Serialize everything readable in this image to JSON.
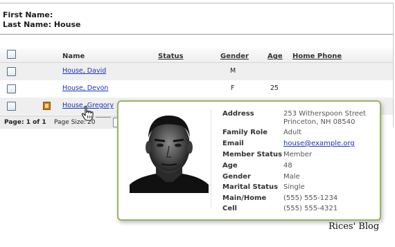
{
  "search_summary": {
    "first_name_label": "First Name:",
    "last_name_label": "Last Name: House"
  },
  "grid": {
    "columns": {
      "name": "Name",
      "status": "Status",
      "gender": "Gender",
      "age": "Age",
      "home_phone": "Home Phone"
    },
    "rows": [
      {
        "name": "House, David",
        "status": "",
        "gender": "M",
        "age": ""
      },
      {
        "name": "House, Devon",
        "status": "",
        "gender": "F",
        "age": "25"
      },
      {
        "name": "House, Gregory",
        "status": "",
        "gender": "",
        "age": ""
      }
    ]
  },
  "pager": {
    "status": "Page: 1 of 1",
    "page_size_label": "Page Size:",
    "page_size_value": "20"
  },
  "tooltip": {
    "address_label": "Address",
    "address_line1": "253 Witherspoon Street",
    "address_line2": "Princeton, NH 08540",
    "family_role_label": "Family Role",
    "family_role": "Adult",
    "email_label": "Email",
    "email": "house@example.org",
    "member_status_label": "Member Status",
    "member_status": "Member",
    "age_label": "Age",
    "age": "48",
    "gender_label": "Gender",
    "gender": "Male",
    "marital_status_label": "Marital Status",
    "marital_status": "Single",
    "main_home_label": "Main/Home",
    "main_home": "(555) 555-1234",
    "cell_label": "Cell",
    "cell": "(555) 555-4321"
  },
  "watermark": "Rices' Blog",
  "colors": {
    "link": "#1a35b5",
    "tooltip_border": "#94b467",
    "row_alt": "#efefef"
  },
  "icons": [
    "person-card-icon",
    "hand-pointer-cursor"
  ]
}
